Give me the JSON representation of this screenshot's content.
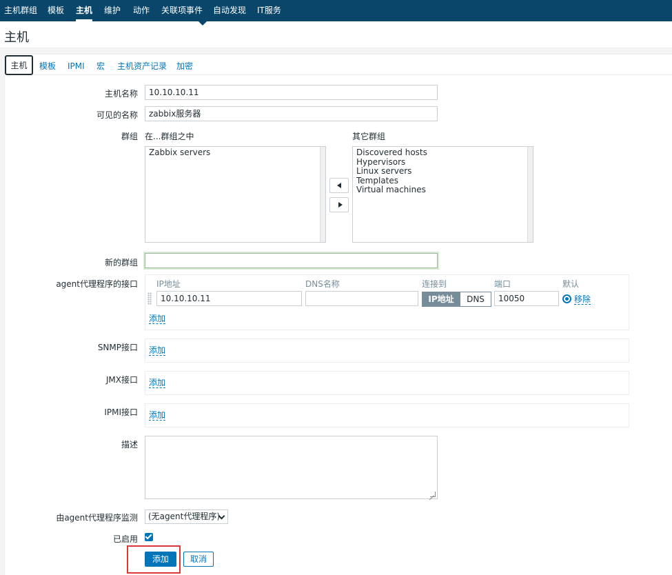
{
  "topnav": {
    "items": [
      "主机群组",
      "模板",
      "主机",
      "维护",
      "动作",
      "关联项事件",
      "自动发现",
      "IT服务"
    ],
    "active_index": 2
  },
  "page": {
    "title": "主机"
  },
  "tabs": [
    "主机",
    "模板",
    "IPMI",
    "宏",
    "主机资产记录",
    "加密"
  ],
  "form": {
    "hostname": {
      "label": "主机名称",
      "value": "10.10.10.11"
    },
    "visible_name": {
      "label": "可见的名称",
      "value": "zabbix服务器"
    },
    "groups": {
      "label": "群组",
      "in_label": "在...群组之中",
      "other_label": "其它群组",
      "in_groups": [
        "Zabbix servers"
      ],
      "other_groups": [
        "Discovered hosts",
        "Hypervisors",
        "Linux servers",
        "Templates",
        "Virtual machines"
      ]
    },
    "new_group": {
      "label": "新的群组",
      "value": ""
    },
    "agent_interfaces": {
      "label": "agent代理程序的接口",
      "headers": {
        "ip": "IP地址",
        "dns": "DNS名称",
        "connect": "连接到",
        "port": "端口",
        "default": "默认"
      },
      "row": {
        "ip": "10.10.10.11",
        "dns": "",
        "connect_ip": "IP地址",
        "connect_dns": "DNS",
        "port": "10050",
        "remove": "移除"
      },
      "add": "添加"
    },
    "snmp": {
      "label": "SNMP接口",
      "add": "添加"
    },
    "jmx": {
      "label": "JMX接口",
      "add": "添加"
    },
    "ipmi": {
      "label": "IPMI接口",
      "add": "添加"
    },
    "description": {
      "label": "描述",
      "value": ""
    },
    "monitored_by": {
      "label": "由agent代理程序监测",
      "value": "(无agent代理程序)"
    },
    "enabled": {
      "label": "已启用",
      "checked": true
    },
    "buttons": {
      "add": "添加",
      "cancel": "取消"
    }
  },
  "colors": {
    "nav_bg": "#0a466a",
    "link": "#0275b8",
    "highlight": "#e03535"
  }
}
